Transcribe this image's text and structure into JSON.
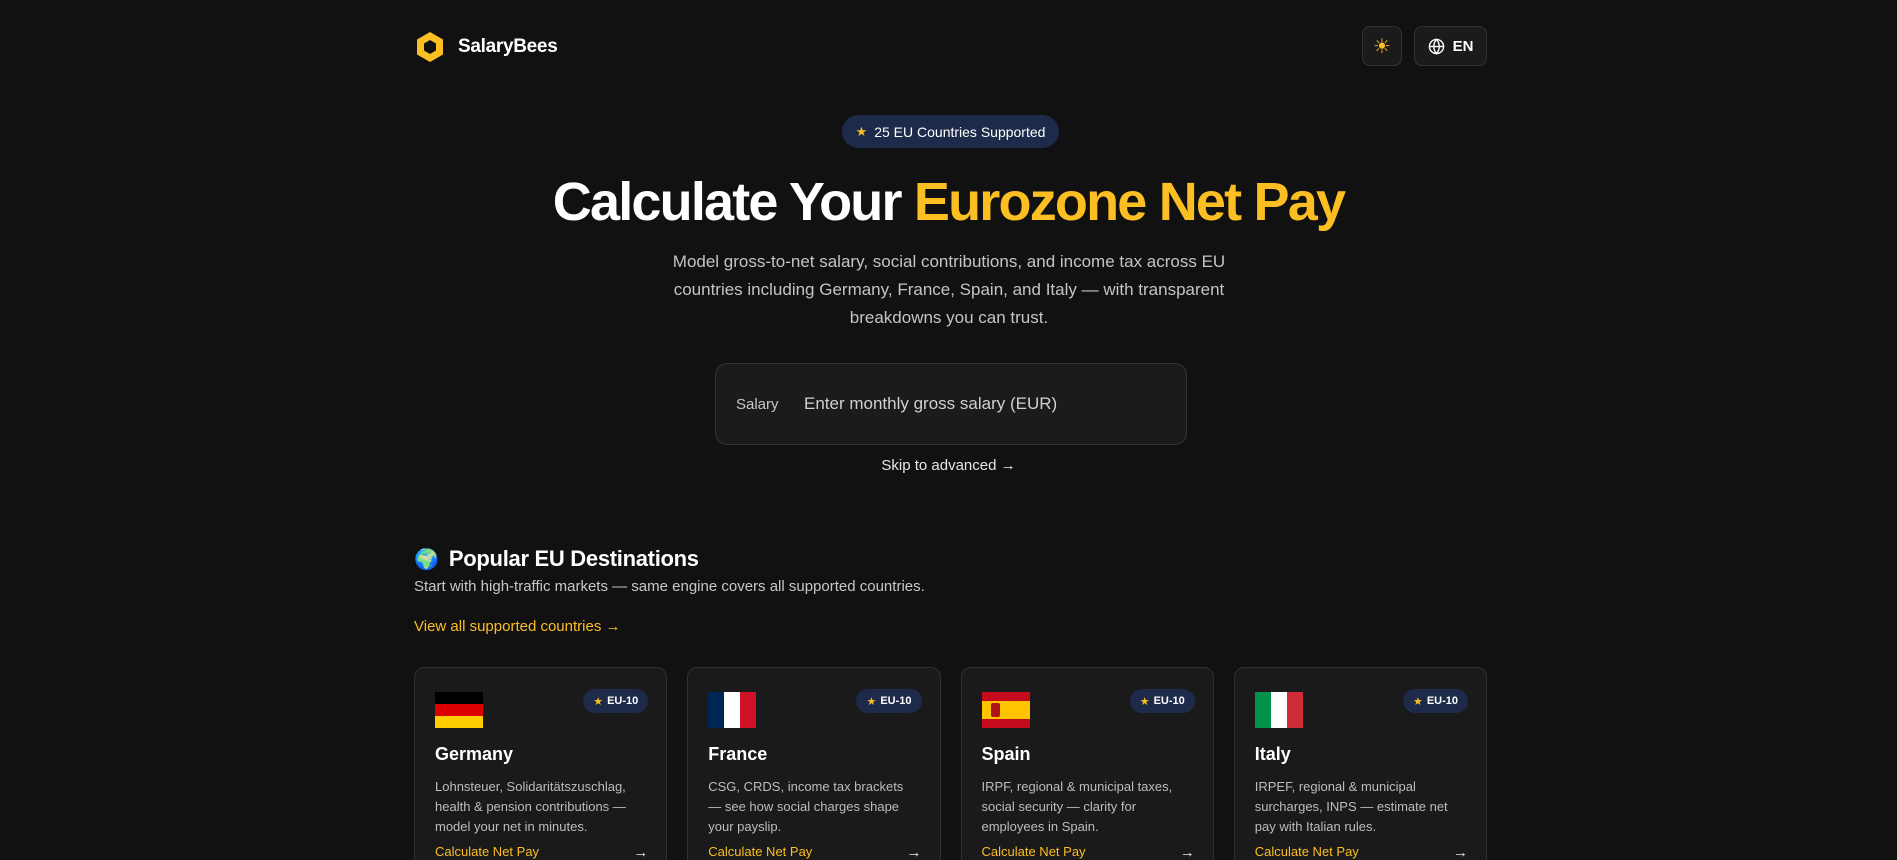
{
  "header": {
    "brand": "SalaryBees",
    "theme_icon": "sun-icon",
    "lang_label": "EN",
    "lang_icon": "globe-icon"
  },
  "hero": {
    "badge": "25 EU Countries Supported",
    "title_plain": "Calculate Your ",
    "title_accent": "Eurozone Net Pay",
    "subtitle": "Model gross-to-net salary, social contributions, and income tax across EU countries including Germany, France, Spain, and Italy — with transparent breakdowns you can trust."
  },
  "salary": {
    "label": "Salary",
    "placeholder": "Enter monthly gross salary (EUR)",
    "value": ""
  },
  "skip_link": "Skip to advanced →",
  "popular": {
    "title": "Popular EU Destinations",
    "subtitle": "Start with high-traffic markets — same engine covers all supported countries.",
    "view_all": "View all supported countries →",
    "cards": [
      {
        "name": "Germany",
        "badge": "EU-10",
        "desc": "Lohnsteuer, Solidaritätszuschlag, health & pension contributions — model your net in minutes.",
        "cta": "Calculate Net Pay",
        "arrow": "→"
      },
      {
        "name": "France",
        "badge": "EU-10",
        "desc": "CSG, CRDS, income tax brackets — see how social charges shape your payslip.",
        "cta": "Calculate Net Pay",
        "arrow": "→"
      },
      {
        "name": "Spain",
        "badge": "EU-10",
        "desc": "IRPF, regional & municipal taxes, social security — clarity for employees in Spain.",
        "cta": "Calculate Net Pay",
        "arrow": "→"
      },
      {
        "name": "Italy",
        "badge": "EU-10",
        "desc": "IRPEF, regional & municipal surcharges, INPS — estimate net pay with Italian rules.",
        "cta": "Calculate Net Pay",
        "arrow": "→"
      }
    ]
  },
  "colors": {
    "background": "#111111",
    "accent": "#fbbf24",
    "badge_bg": "#1e2a4a",
    "card_bg": "#1a1a1a"
  }
}
